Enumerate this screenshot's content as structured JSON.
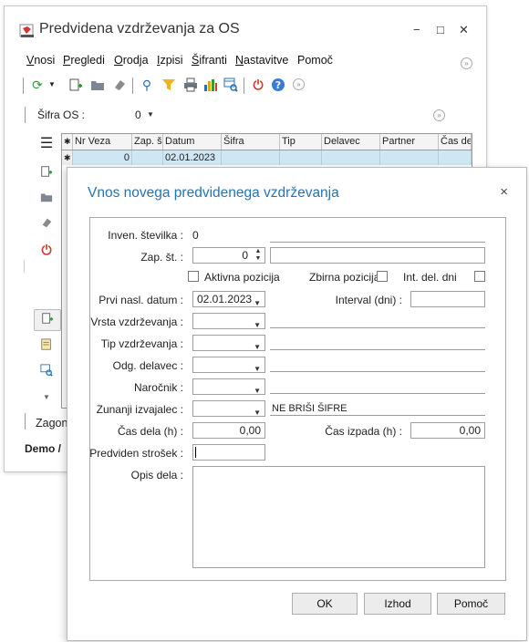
{
  "main_window": {
    "title": "Predvidena vzdrževanja za OS",
    "controls": {
      "minimize": "−",
      "maximize": "□",
      "close": "✕"
    },
    "menu": [
      {
        "label": "Vnosi",
        "mnemonic": "V"
      },
      {
        "label": "Pregledi",
        "mnemonic": "P"
      },
      {
        "label": "Orodja",
        "mnemonic": "O"
      },
      {
        "label": "Izpisi",
        "mnemonic": "I"
      },
      {
        "label": "Šifranti",
        "mnemonic": "Š"
      },
      {
        "label": "Nastavitve",
        "mnemonic": "N"
      },
      {
        "label": "Pomoč",
        "mnemonic": ""
      }
    ],
    "toolbar_icons": [
      "refresh-icon",
      "new-record-icon",
      "folder-icon",
      "eraser-icon",
      "search-icon",
      "filter-icon",
      "print-icon",
      "chart-icon",
      "find-in-table-icon",
      "power-icon",
      "help-icon",
      "collapse-icon"
    ],
    "filter": {
      "label": "Šifra OS :",
      "value": "0"
    },
    "grid": {
      "columns": [
        "Nr Veza",
        "Zap. š",
        "Datum",
        "Šifra",
        "Tip",
        "Delavec",
        "Partner",
        "Čas de"
      ],
      "rows": [
        [
          "0",
          "",
          "02.01.2023",
          "",
          "",
          "",
          "",
          ""
        ]
      ]
    },
    "status": {
      "zagons": "Zagons",
      "demo": "Demo /"
    }
  },
  "dialog": {
    "title": "Vnos novega predvidenega vzdrževanja",
    "close": "×",
    "fields": {
      "inven_stevilka": {
        "label": "Inven. številka :",
        "value": "0"
      },
      "zap_st": {
        "label": "Zap. št. :",
        "value": "0"
      },
      "aktivna_pozicija": {
        "label": "Aktivna pozicija",
        "checked": false
      },
      "zbirna_pozicija": {
        "label": "Zbirna pozicija",
        "checked": false
      },
      "int_del_dni": {
        "label": "Int. del. dni",
        "checked": false
      },
      "prvi_nasl_datum": {
        "label": "Prvi nasl. datum :",
        "value": "02.01.2023"
      },
      "interval": {
        "label": "Interval (dni) :",
        "value": ""
      },
      "vrsta_vzdrzevanja": {
        "label": "Vrsta vzdrževanja :",
        "value": ""
      },
      "tip_vzdrzevanja": {
        "label": "Tip vzdrževanja :",
        "value": ""
      },
      "odg_delavec": {
        "label": "Odg. delavec :",
        "value": ""
      },
      "narocnik": {
        "label": "Naročnik :",
        "value": ""
      },
      "zunanji_izvajalec": {
        "label": "Zunanji izvajalec :",
        "value": "",
        "note": "NE BRIŠI ŠIFRE"
      },
      "cas_dela": {
        "label": "Čas dela (h) :",
        "value": "0,00"
      },
      "cas_izpada": {
        "label": "Čas izpada (h) :",
        "value": "0,00"
      },
      "predviden_strosek": {
        "label": "Predviden strošek :",
        "value": ""
      },
      "opis_dela": {
        "label": "Opis dela :",
        "value": ""
      }
    },
    "buttons": {
      "ok": "OK",
      "izhod": "Izhod",
      "pomoc": "Pomoč"
    }
  }
}
